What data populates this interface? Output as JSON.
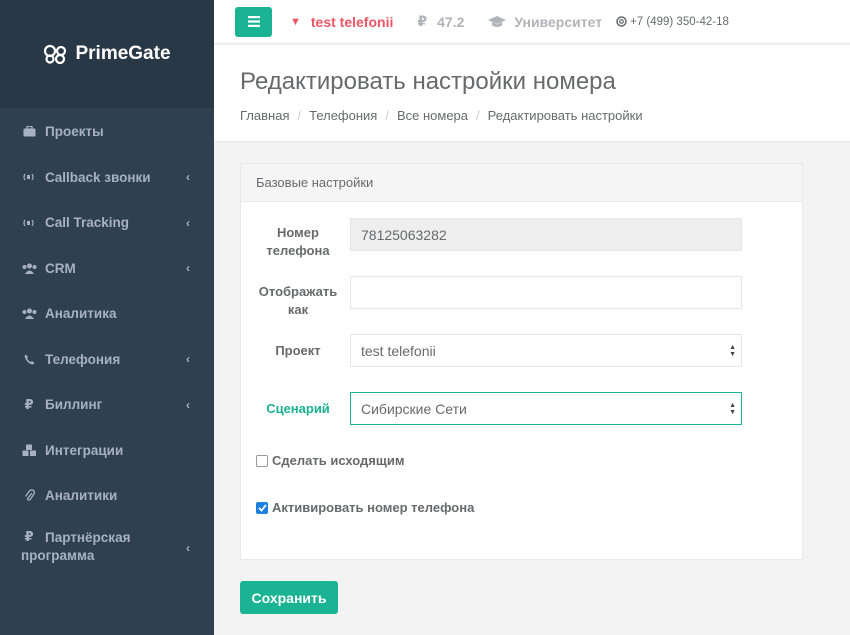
{
  "brand": {
    "name": "PrimeGate"
  },
  "sidebar": {
    "items": [
      {
        "label": "Проекты",
        "icon": "briefcase-icon",
        "has_submenu": false
      },
      {
        "label": "Callback звонки",
        "icon": "volume-icon",
        "has_submenu": true
      },
      {
        "label": "Call Tracking",
        "icon": "volume-icon",
        "has_submenu": true
      },
      {
        "label": "CRM",
        "icon": "users-icon",
        "has_submenu": true
      },
      {
        "label": "Аналитика",
        "icon": "users-icon",
        "has_submenu": false
      },
      {
        "label": "Телефония",
        "icon": "phone-icon",
        "has_submenu": true
      },
      {
        "label": "Биллинг",
        "icon": "ruble-icon",
        "has_submenu": true
      },
      {
        "label": "Интеграции",
        "icon": "cubes-icon",
        "has_submenu": false
      },
      {
        "label": "Аналитики",
        "icon": "paperclip-icon",
        "has_submenu": false
      },
      {
        "label_line1": "Партнёрская",
        "label_line2": "программа",
        "icon": "ruble-icon",
        "has_submenu": true
      }
    ]
  },
  "topbar": {
    "project": "test telefonii",
    "balance": "47.2",
    "university": "Университет",
    "phone": "+7 (499) 350-42-18"
  },
  "page": {
    "title": "Редактировать настройки номера",
    "breadcrumb": [
      "Главная",
      "Телефония",
      "Все номера",
      "Редактировать настройки"
    ]
  },
  "form": {
    "panel_title": "Базовые настройки",
    "phone_label_line1": "Номер",
    "phone_label_line2": "телефона",
    "phone_value": "78125063282",
    "display_label_line1": "Отображать",
    "display_label_line2": "как",
    "display_value": "",
    "project_label": "Проект",
    "project_value": "test telefonii",
    "scenario_label": "Сценарий",
    "scenario_value": "Сибирские Сети",
    "outgoing_label": "Сделать исходящим",
    "outgoing_checked": false,
    "activate_label": "Активировать номер телефона",
    "activate_checked": true
  },
  "actions": {
    "save_label": "Сохранить"
  },
  "colors": {
    "accent": "#1ab394",
    "sidebar_bg": "#2f4050",
    "project_red": "#ed5565",
    "checkbox_blue": "#1d7fe0"
  }
}
